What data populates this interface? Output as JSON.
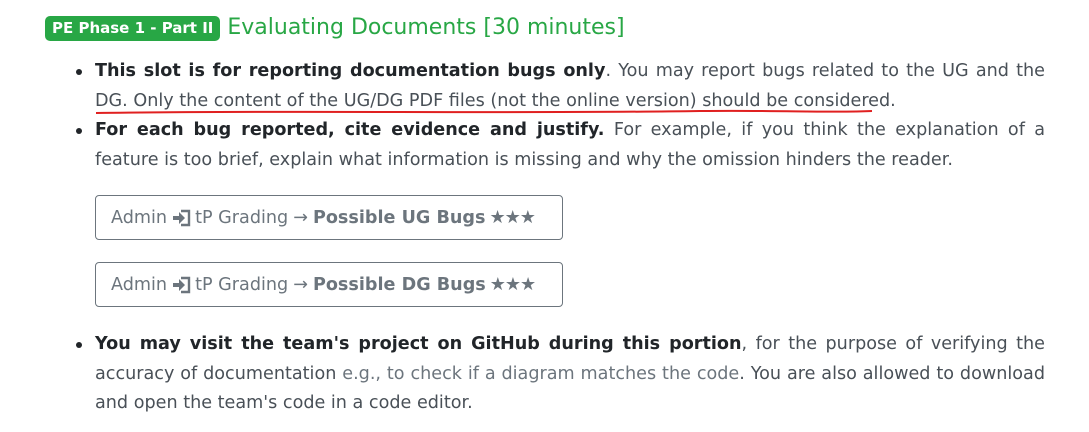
{
  "heading": {
    "badge": "PE Phase 1 - Part II",
    "title": "Evaluating Documents [30 minutes]"
  },
  "bullets": {
    "b1": {
      "bold": "This slot is for reporting documentation bugs only",
      "rest": ". You may report bugs related to the UG and the DG.",
      "underlined": "Only the content of the UG/DG PDF files (not the online version) should be considered."
    },
    "b2": {
      "bold": "For each bug reported, cite evidence and justify.",
      "rest": " For example, if you think the explanation of a feature is too brief, explain what information is missing and why the omission hinders the reader."
    },
    "b3": {
      "bold": "You may visit the team's project on GitHub during this portion",
      "rest1": ", for the purpose of verifying the accuracy of documentation ",
      "muted": "e.g., to check if a diagram matches the code",
      "rest2": ". You are also allowed to download and open the team's code in a code editor."
    }
  },
  "nav_paths": [
    {
      "part1": "Admin",
      "icon": "sign-in-icon",
      "part2": "tP Grading",
      "arrow": "→",
      "target": "Possible UG Bugs",
      "stars": "★★★"
    },
    {
      "part1": "Admin",
      "icon": "sign-in-icon",
      "part2": "tP Grading",
      "arrow": "→",
      "target": "Possible DG Bugs",
      "stars": "★★★"
    }
  ],
  "colors": {
    "accent": "#28a745",
    "underline": "#e02020",
    "text": "#212529",
    "muted": "#6c757d"
  }
}
